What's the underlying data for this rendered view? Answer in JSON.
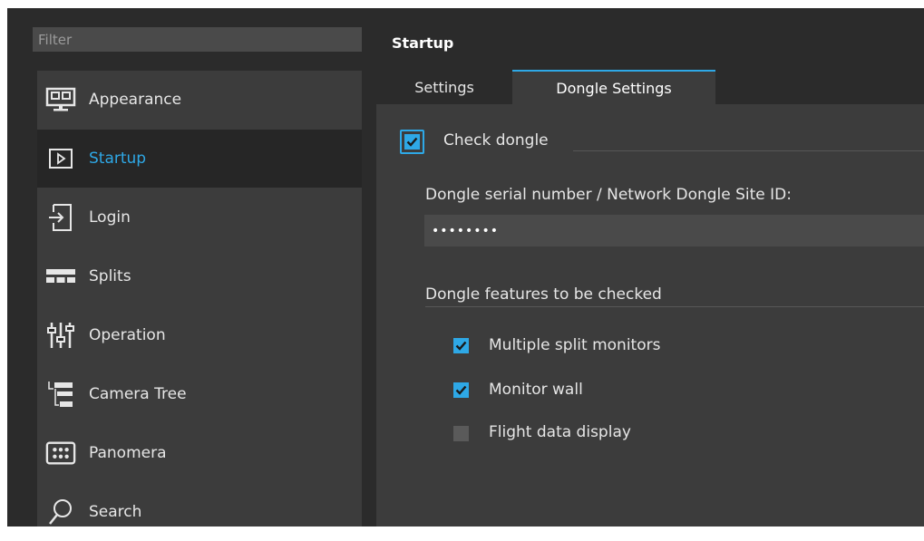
{
  "sidebar": {
    "filter_placeholder": "Filter",
    "items": [
      {
        "label": "Appearance",
        "icon": "monitor-icon",
        "selected": false
      },
      {
        "label": "Startup",
        "icon": "play-icon",
        "selected": true
      },
      {
        "label": "Login",
        "icon": "login-icon",
        "selected": false
      },
      {
        "label": "Splits",
        "icon": "splits-icon",
        "selected": false
      },
      {
        "label": "Operation",
        "icon": "sliders-icon",
        "selected": false
      },
      {
        "label": "Camera Tree",
        "icon": "tree-icon",
        "selected": false
      },
      {
        "label": "Panomera",
        "icon": "panomera-icon",
        "selected": false
      },
      {
        "label": "Search",
        "icon": "search-icon",
        "selected": false
      }
    ]
  },
  "main": {
    "title": "Startup",
    "tabs": [
      {
        "label": "Settings",
        "active": false
      },
      {
        "label": "Dongle Settings",
        "active": true
      }
    ],
    "check_dongle": {
      "label": "Check dongle",
      "checked": true
    },
    "serial_label": "Dongle serial number / Network Dongle Site ID:",
    "serial_value": "••••••••",
    "features_label": "Dongle features to be checked",
    "features": [
      {
        "label": "Multiple split monitors",
        "checked": true
      },
      {
        "label": "Monitor wall",
        "checked": true
      },
      {
        "label": "Flight data display",
        "checked": false
      }
    ]
  },
  "colors": {
    "accent": "#2ea8e6",
    "background": "#2b2b2b",
    "panel": "#3c3c3c",
    "selected_item": "#262626"
  }
}
